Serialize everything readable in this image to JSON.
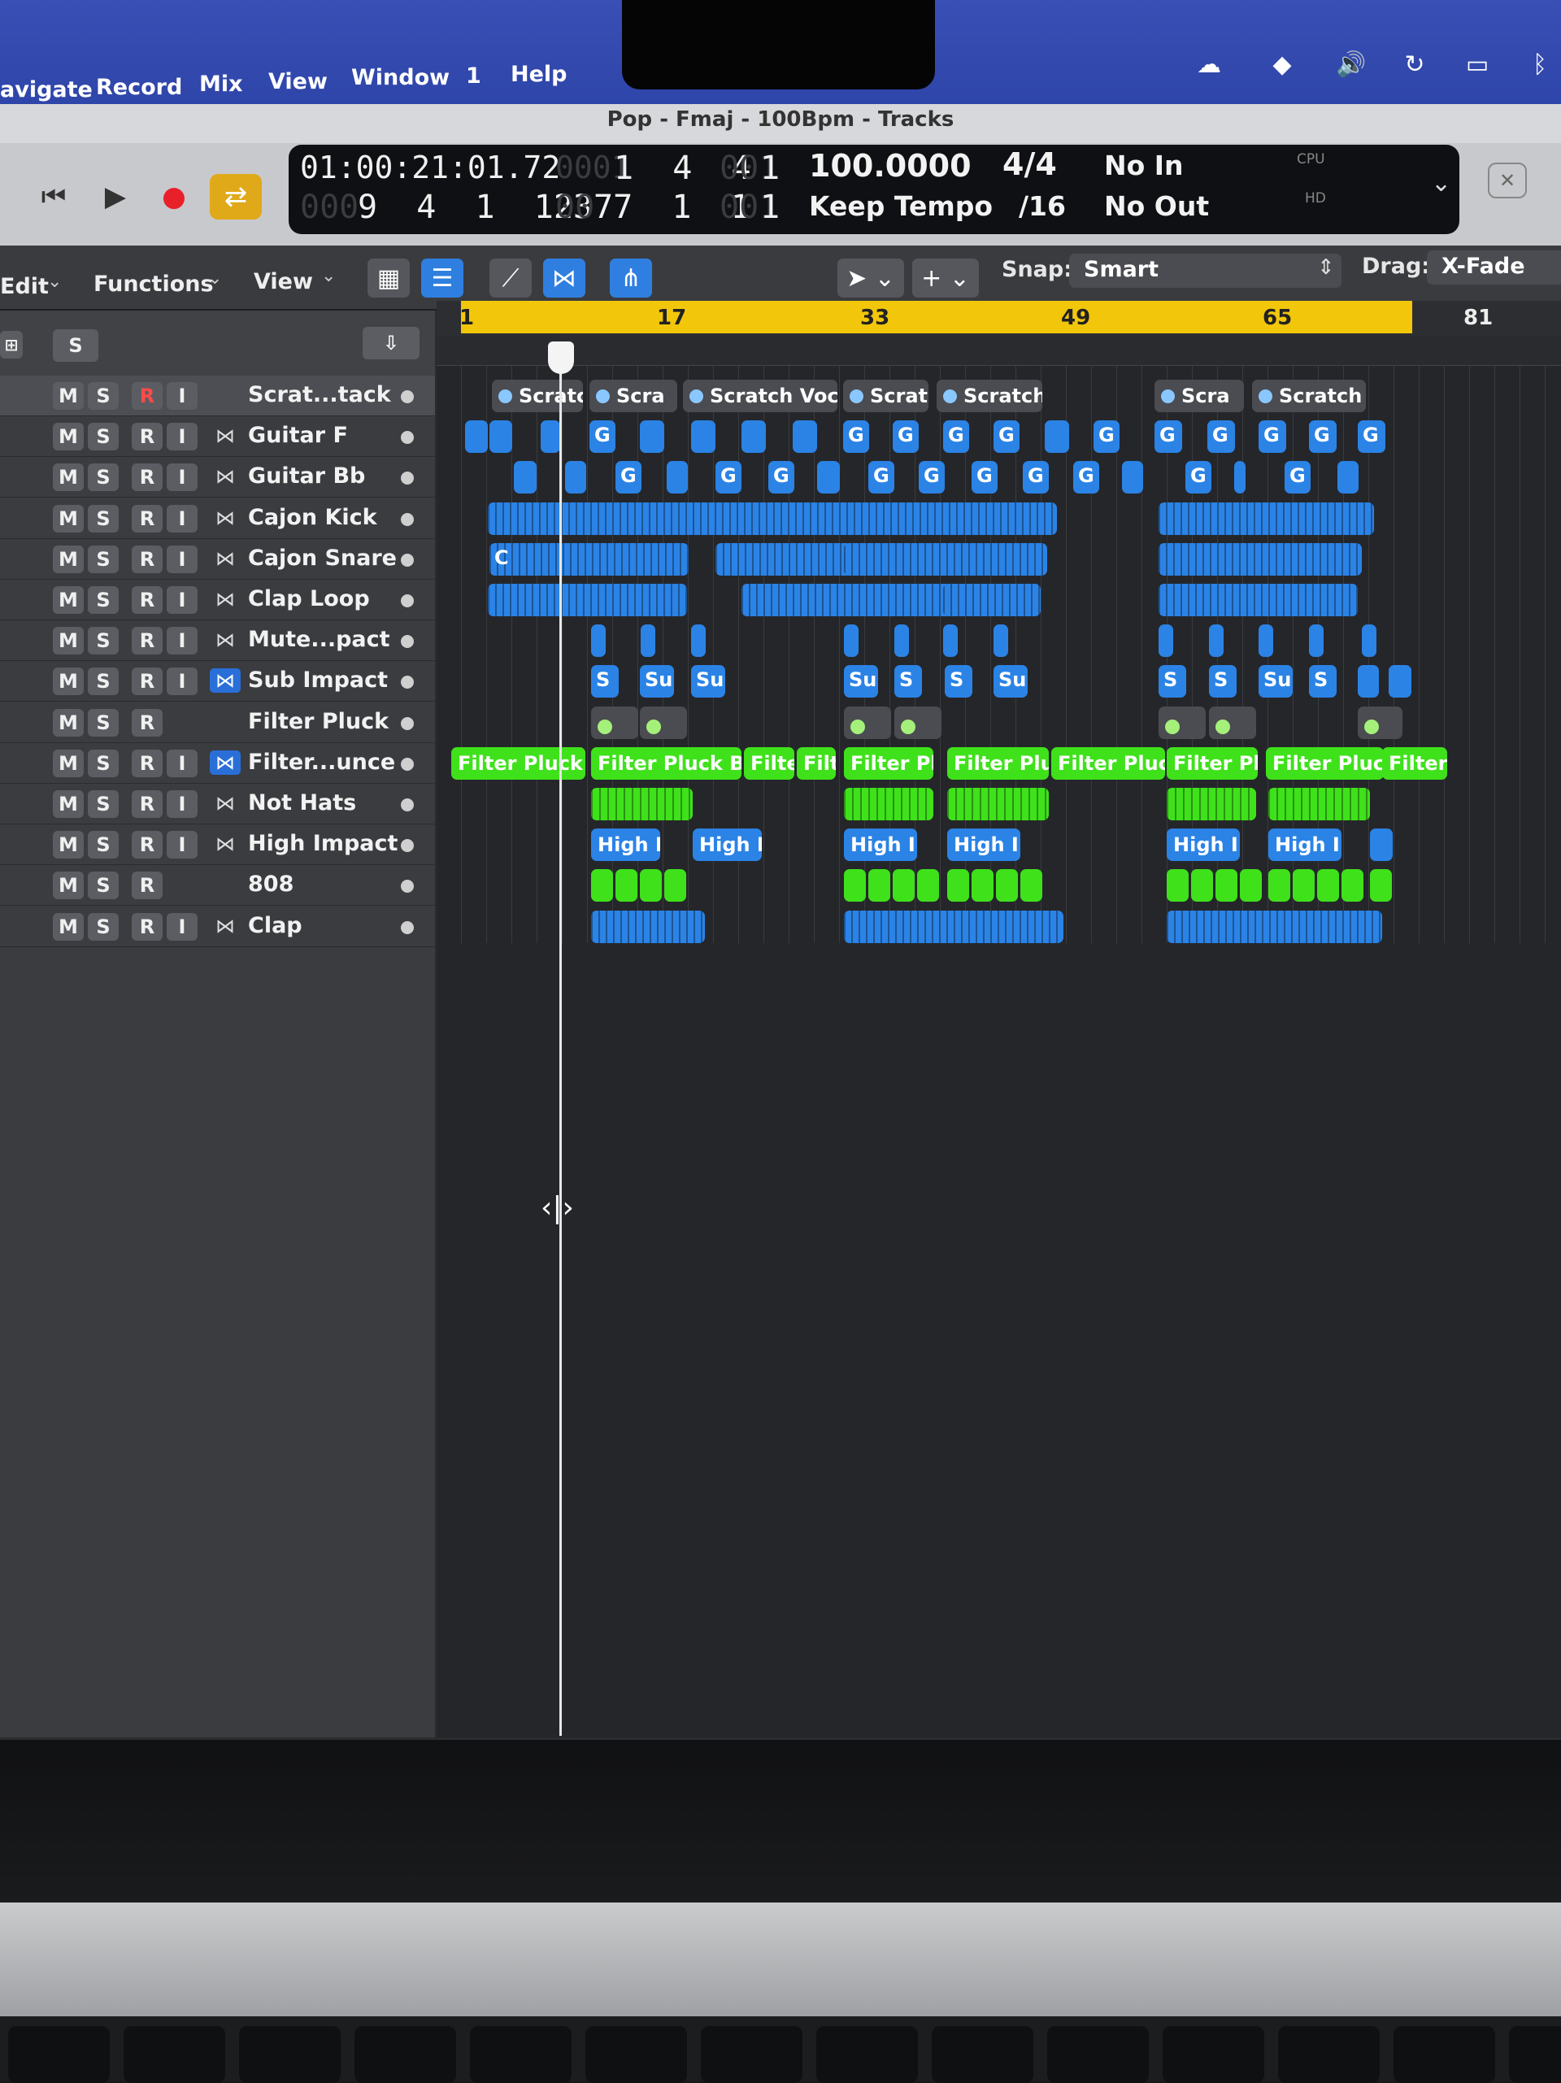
{
  "menubar": {
    "items": [
      "avigate",
      "Record",
      "Mix",
      "View",
      "Window",
      "1",
      "Help"
    ]
  },
  "window": {
    "title": "Pop - Fmaj - 100Bpm - Tracks"
  },
  "lcd": {
    "time": "01:00:21:01.72",
    "position_bars": "1  4  4",
    "position_ticks": "1",
    "position_prefix_dim": "0001",
    "sub_prefix_dim": "000",
    "sub": "9  4  1  123",
    "end_prefix_dim": "00",
    "end": "77  1  1",
    "end_ticks": "1",
    "dim_mid": "001",
    "tempo": "100.0000",
    "tempo_mode": "Keep Tempo",
    "signature": "4/4",
    "division": "/16",
    "in": "No In",
    "out": "No Out",
    "cpu_label": "CPU",
    "hd_label": "HD"
  },
  "toolbar": {
    "edit": "Edit",
    "functions": "Functions",
    "view": "View",
    "snap_label": "Snap:",
    "snap_value": "Smart",
    "drag_label": "Drag:",
    "drag_value": "X-Fade"
  },
  "header": {
    "solo_label": "S"
  },
  "ruler": {
    "bars": [
      "1",
      "17",
      "33",
      "49",
      "65",
      "81"
    ]
  },
  "tracks": [
    {
      "name": "Scrat...tack",
      "icon": "none"
    },
    {
      "name": "Guitar F",
      "icon": "midi-icon"
    },
    {
      "name": "Guitar Bb",
      "icon": "midi-icon"
    },
    {
      "name": "Cajon Kick",
      "icon": "midi-icon"
    },
    {
      "name": "Cajon Snare",
      "icon": "midi-icon"
    },
    {
      "name": "Clap Loop",
      "icon": "midi-icon"
    },
    {
      "name": "Mute...pact",
      "icon": "midi-icon"
    },
    {
      "name": "Sub Impact",
      "icon": "midi-icon-active"
    },
    {
      "name": "Filter Pluck",
      "icon": "none"
    },
    {
      "name": "Filter...unce",
      "icon": "midi-icon-active"
    },
    {
      "name": "Not Hats",
      "icon": "midi-icon"
    },
    {
      "name": "High Impact",
      "icon": "midi-icon"
    },
    {
      "name": "808",
      "icon": "none"
    },
    {
      "name": "Clap",
      "icon": "midi-icon"
    }
  ],
  "btn": {
    "m": "M",
    "s": "S",
    "r": "R",
    "i": "I"
  },
  "regions": {
    "scratch": [
      "Scratc",
      "Scra",
      "Scratch Voca",
      "Scrat",
      "Scratch",
      "Scra",
      "Scratch"
    ],
    "g": "G",
    "c": "C",
    "s": "S",
    "su": "Su",
    "filter": [
      "Filter Pluck B",
      "Filter Pluck Bou",
      "Filte",
      "Filt",
      "Filter Pl",
      "Filter Pluc",
      "Filter Pluck",
      "Filter Pl",
      "Filter Pluck",
      "Filter"
    ],
    "high": "High I"
  },
  "colors": {
    "cycle": "#f2c70b",
    "midi_region": "#2b83e6",
    "audio_region": "#3fe11b",
    "menubar": "#3a4fb5"
  }
}
